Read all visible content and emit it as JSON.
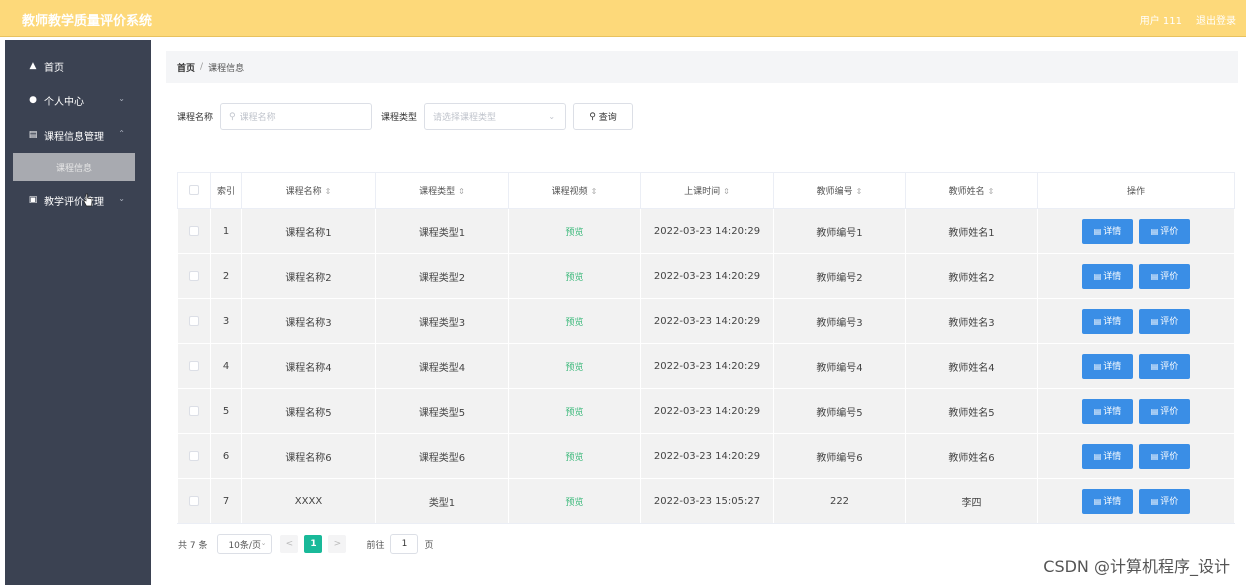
{
  "header": {
    "app_title": "教师教学质量评价系统",
    "user_label": "用户 111",
    "logout_label": "退出登录"
  },
  "sidebar": {
    "items": [
      {
        "label": "首页",
        "icon": "home-icon"
      },
      {
        "label": "个人中心",
        "icon": "user-icon"
      },
      {
        "label": "课程信息管理",
        "icon": "list-icon"
      },
      {
        "label": "教学评价管理",
        "icon": "clipboard-icon"
      }
    ],
    "submenu_label": "课程信息"
  },
  "breadcrumb": {
    "home": "首页",
    "separator": "/",
    "current": "课程信息"
  },
  "filters": {
    "course_name_label": "课程名称",
    "course_name_placeholder": "课程名称",
    "course_type_label": "课程类型",
    "course_type_placeholder": "请选择课程类型",
    "search_label": "查询"
  },
  "table": {
    "headers": [
      "索引",
      "课程名称",
      "课程类型",
      "课程视频",
      "上课时间",
      "教师编号",
      "教师姓名",
      "操作"
    ],
    "rows": [
      {
        "index": "1",
        "name": "课程名称1",
        "type": "课程类型1",
        "video": "预览",
        "time": "2022-03-23 14:20:29",
        "teacher_no": "教师编号1",
        "teacher_name": "教师姓名1"
      },
      {
        "index": "2",
        "name": "课程名称2",
        "type": "课程类型2",
        "video": "预览",
        "time": "2022-03-23 14:20:29",
        "teacher_no": "教师编号2",
        "teacher_name": "教师姓名2"
      },
      {
        "index": "3",
        "name": "课程名称3",
        "type": "课程类型3",
        "video": "预览",
        "time": "2022-03-23 14:20:29",
        "teacher_no": "教师编号3",
        "teacher_name": "教师姓名3"
      },
      {
        "index": "4",
        "name": "课程名称4",
        "type": "课程类型4",
        "video": "预览",
        "time": "2022-03-23 14:20:29",
        "teacher_no": "教师编号4",
        "teacher_name": "教师姓名4"
      },
      {
        "index": "5",
        "name": "课程名称5",
        "type": "课程类型5",
        "video": "预览",
        "time": "2022-03-23 14:20:29",
        "teacher_no": "教师编号5",
        "teacher_name": "教师姓名5"
      },
      {
        "index": "6",
        "name": "课程名称6",
        "type": "课程类型6",
        "video": "预览",
        "time": "2022-03-23 14:20:29",
        "teacher_no": "教师编号6",
        "teacher_name": "教师姓名6"
      },
      {
        "index": "7",
        "name": "XXXX",
        "type": "类型1",
        "video": "预览",
        "time": "2022-03-23 15:05:27",
        "teacher_no": "222",
        "teacher_name": "李四"
      }
    ],
    "detail_label": "详情",
    "evaluate_label": "评价"
  },
  "pagination": {
    "total": "共 7 条",
    "page_size": "10条/页",
    "prev": "<",
    "current_page": "1",
    "next": ">",
    "goto_label": "前往",
    "goto_value": "1",
    "goto_unit": "页"
  },
  "watermark": "CSDN @计算机程序_设计",
  "colors": {
    "header_bg": "#fdd97a",
    "sidebar_bg": "#3b4252",
    "primary_button": "#3a8ee6",
    "pager_active": "#19b999",
    "preview_link": "#3cb97b"
  }
}
